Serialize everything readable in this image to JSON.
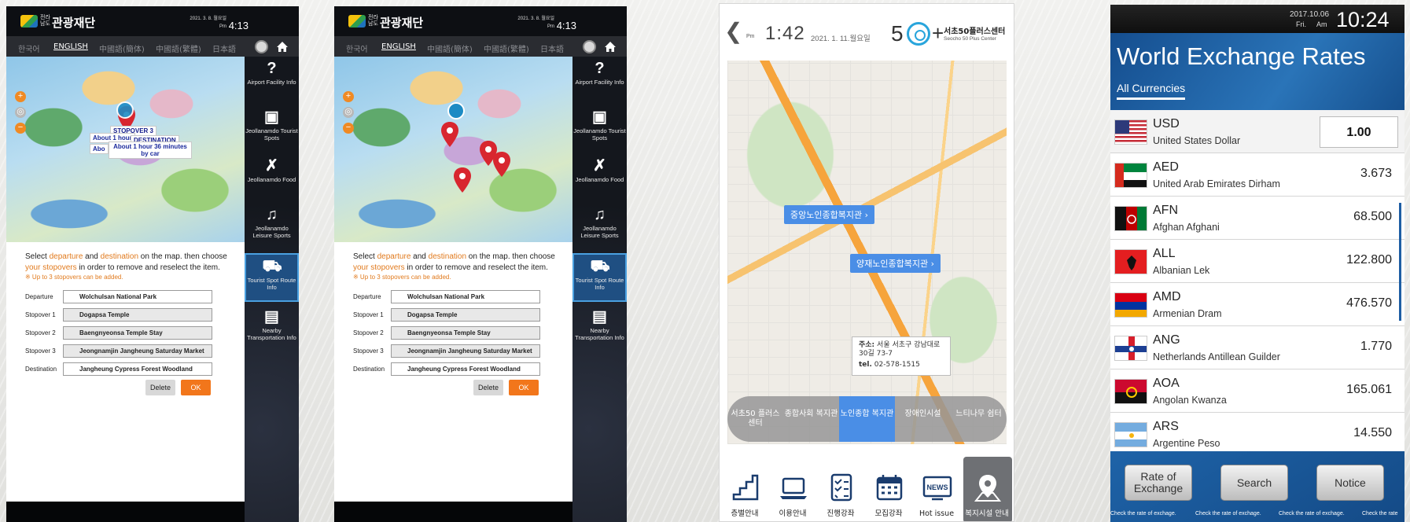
{
  "kiosk": {
    "logo_small": "전라남도",
    "logo_text": "관광재단",
    "date": "2021. 3. 8. 월요일",
    "ampm": "Pm",
    "time": "4:13",
    "languages": [
      "한국어",
      "ENGLISH",
      "中國語(簡体)",
      "中國語(繁體)",
      "日本語"
    ],
    "active_language": "ENGLISH",
    "sidebar": [
      {
        "label": "Airport Facility Info",
        "icon": "question-icon",
        "glyph": "?"
      },
      {
        "label": "Jeollanamdo Tourist Spots",
        "icon": "bag-icon",
        "glyph": "▣"
      },
      {
        "label": "Jeollanamdo Food",
        "icon": "fork-knife-icon",
        "glyph": "🍴"
      },
      {
        "label": "Jeollanamdo Leisure Sports",
        "icon": "music-note-icon",
        "glyph": "♫"
      },
      {
        "label": "Tourist Spot Route Info",
        "icon": "car-icon",
        "glyph": "🚗"
      },
      {
        "label": "Nearby Transportation Info",
        "icon": "bus-icon",
        "glyph": "🚌"
      }
    ],
    "instruction": {
      "p1": "Select ",
      "departure": "departure",
      "p2": " and ",
      "destination": "destination",
      "p3": " on the map. then choose ",
      "stopovers": "your stopovers",
      "p4": " in order to remove and reselect the item.",
      "note": "※ Up to 3 stopovers can be added."
    },
    "form": [
      {
        "label": "Departure",
        "value": "Wolchulsan National Park"
      },
      {
        "label": "Stopover 1",
        "value": "Dogapsa Temple"
      },
      {
        "label": "Stopover 2",
        "value": "Baengnyeonsa Temple Stay"
      },
      {
        "label": "Stopover 3",
        "value": "Jeongnamjin Jangheung Saturday Market"
      },
      {
        "label": "Destination",
        "value": "Jangheung Cypress Forest Woodland"
      }
    ],
    "delete_label": "Delete",
    "ok_label": "OK",
    "map_tooltips": {
      "t1": "STOPOVER 3",
      "t2": "About 1 hour",
      "t3": "DESTINATION",
      "t4": "About 1 hour 36 minutes by car",
      "t5": "Abo"
    }
  },
  "seocho": {
    "ampm": "Pm",
    "time": "1:42",
    "date": "2021. 1. 11.월요일",
    "brand_num": "5",
    "brand_plus": "+",
    "brand_ko": "서초50플러스센터",
    "brand_en": "Seocho 50 Plus Center",
    "callout1": "중앙노인종합복지관 ›",
    "callout2": "양재노인종합복지관 ›",
    "address_label": "주소:",
    "address": "서울 서초구 강남대로30길 73-7",
    "tel_label": "tel.",
    "tel": "02-578-1515",
    "tabs": [
      "서초50 플러스센터",
      "종합사회 복지관",
      "노인종합 복지관",
      "장애인시설",
      "느티나무 쉼터"
    ],
    "active_tab": 2,
    "dock": [
      {
        "label": "층별안내",
        "icon": "stairs-icon"
      },
      {
        "label": "이용안내",
        "icon": "laptop-icon"
      },
      {
        "label": "진행강좌",
        "icon": "checklist-icon"
      },
      {
        "label": "모집강좌",
        "icon": "calendar-icon"
      },
      {
        "label": "Hot issue",
        "icon": "news-icon",
        "badge": "NEWS"
      },
      {
        "label": "복지시설 안내",
        "icon": "location-pin-icon"
      }
    ]
  },
  "exchange": {
    "status_date": "2017.10.06",
    "status_day": "Fri.",
    "status_ampm": "Am",
    "status_time": "10:24",
    "title": "World Exchange Rates",
    "subtab": "All Currencies",
    "rows": [
      {
        "code": "USD",
        "name": "United States Dollar",
        "rate": "1.00",
        "flag": "flag-usd-icon"
      },
      {
        "code": "AED",
        "name": "United Arab Emirates Dirham",
        "rate": "3.673",
        "flag": "flag-aed-icon"
      },
      {
        "code": "AFN",
        "name": "Afghan Afghani",
        "rate": "68.500",
        "flag": "flag-afn-icon"
      },
      {
        "code": "ALL",
        "name": "Albanian Lek",
        "rate": "122.800",
        "flag": "flag-all-icon"
      },
      {
        "code": "AMD",
        "name": "Armenian Dram",
        "rate": "476.570",
        "flag": "flag-amd-icon"
      },
      {
        "code": "ANG",
        "name": "Netherlands Antillean Guilder",
        "rate": "1.770",
        "flag": "flag-ang-icon"
      },
      {
        "code": "AOA",
        "name": "Angolan Kwanza",
        "rate": "165.061",
        "flag": "flag-aoa-icon"
      },
      {
        "code": "ARS",
        "name": "Argentine Peso",
        "rate": "14.550",
        "flag": "flag-ars-icon"
      }
    ],
    "buttons": [
      {
        "label1": "Rate of",
        "label2": "Exchange",
        "caption": "Check the rate of exchage."
      },
      {
        "label1": "Search",
        "label2": "",
        "caption": "Check the rate of exchage."
      },
      {
        "label1": "Notice",
        "label2": "",
        "caption": "Check the rate of exchage."
      }
    ],
    "extra_caption": "Check the rate"
  }
}
